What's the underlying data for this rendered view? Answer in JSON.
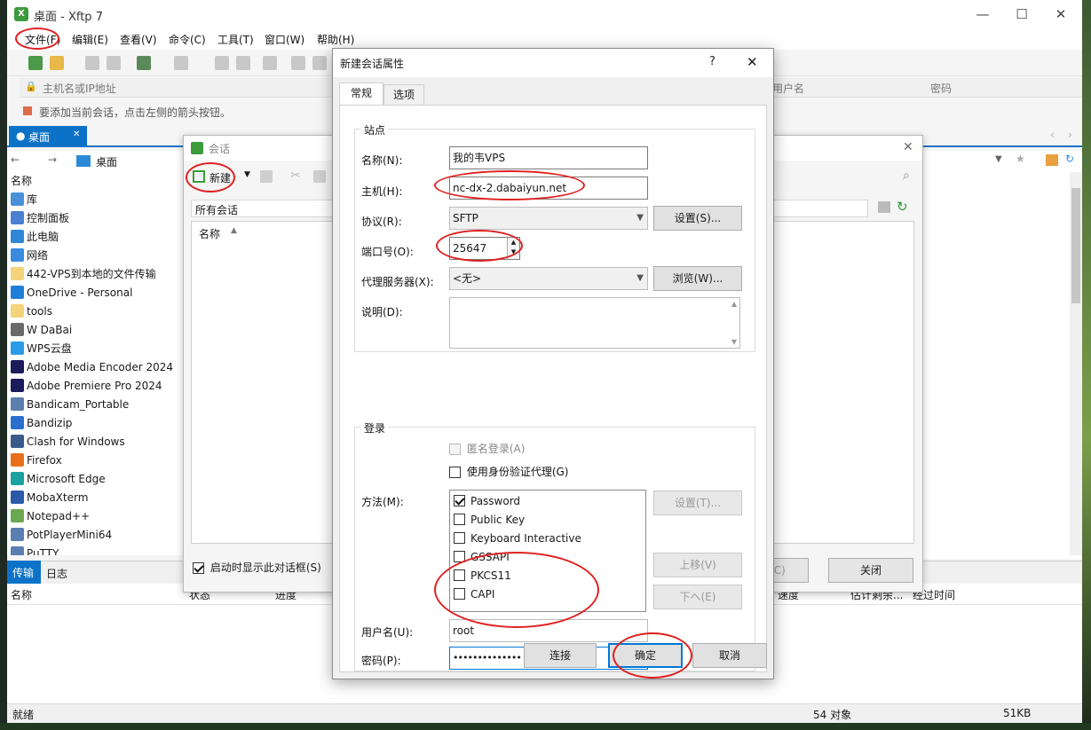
{
  "window": {
    "title": "桌面 - Xftp 7",
    "app_icon": "xftp-app-icon"
  },
  "menu": [
    "文件(F)",
    "编辑(E)",
    "查看(V)",
    "命令(C)",
    "工具(T)",
    "窗口(W)",
    "帮助(H)"
  ],
  "address": {
    "host_placeholder": "主机名或IP地址",
    "username_col": "用户名",
    "password_col": "密码"
  },
  "info_text": "要添加当前会话，点击左侧的箭头按钮。",
  "local_tab": {
    "label": "桌面"
  },
  "path": {
    "current": "桌面"
  },
  "file_list": {
    "header": "名称",
    "items": [
      {
        "label": "库",
        "icon": "library-icon",
        "color": "#4a90d9"
      },
      {
        "label": "控制面板",
        "icon": "control-panel-icon",
        "color": "#4a7fd1"
      },
      {
        "label": "此电脑",
        "icon": "computer-icon",
        "color": "#2f86d6"
      },
      {
        "label": "网络",
        "icon": "network-icon",
        "color": "#3a8be0"
      },
      {
        "label": "442-VPS到本地的文件传输",
        "icon": "folder-icon",
        "color": "#f4d37a"
      },
      {
        "label": "OneDrive - Personal",
        "icon": "onedrive-icon",
        "color": "#1f7fd8"
      },
      {
        "label": "tools",
        "icon": "folder-icon",
        "color": "#f4d37a"
      },
      {
        "label": "W DaBai",
        "icon": "user-icon",
        "color": "#6a6a6a"
      },
      {
        "label": "WPS云盘",
        "icon": "cloud-icon",
        "color": "#2a9be8"
      },
      {
        "label": "Adobe Media Encoder 2024",
        "icon": "media-encoder-icon",
        "color": "#1b1b5c"
      },
      {
        "label": "Adobe Premiere Pro 2024",
        "icon": "premiere-icon",
        "color": "#1b1b5c"
      },
      {
        "label": "Bandicam_Portable",
        "icon": "shortcut-icon",
        "color": "#5a7fb0"
      },
      {
        "label": "Bandizip",
        "icon": "bandizip-icon",
        "color": "#2a6fd0"
      },
      {
        "label": "Clash for Windows",
        "icon": "clash-icon",
        "color": "#3a5a8a"
      },
      {
        "label": "Firefox",
        "icon": "firefox-icon",
        "color": "#e8701a"
      },
      {
        "label": "Microsoft Edge",
        "icon": "edge-icon",
        "color": "#1aa2a0"
      },
      {
        "label": "MobaXterm",
        "icon": "mobaxterm-icon",
        "color": "#2a5aa8"
      },
      {
        "label": "Notepad++",
        "icon": "notepad-icon",
        "color": "#6aa84f"
      },
      {
        "label": "PotPlayerMini64",
        "icon": "potplayer-icon",
        "color": "#5a7fb0"
      },
      {
        "label": "PuTTY",
        "icon": "putty-icon",
        "color": "#5a7fb0"
      }
    ]
  },
  "bottom_tabs": {
    "transfer": "传输",
    "log": "日志"
  },
  "transfer_columns": [
    "名称",
    "状态",
    "进度",
    "速度",
    "估计剩余...",
    "经过时间"
  ],
  "status": {
    "left": "就绪",
    "objects": "54 对象",
    "size": "51KB"
  },
  "sessions_dialog": {
    "title": "会话",
    "new_button": "新建",
    "folder": "所有会话",
    "list_header": "名称",
    "show_on_start": "启动时显示此对话框(S)",
    "connect_button": "连接(C)",
    "close_button": "关闭"
  },
  "prop_dialog": {
    "title": "新建会话属性",
    "help": "?",
    "tabs": [
      "常规",
      "选项"
    ],
    "site_group": "站点",
    "name_label": "名称(N):",
    "name_value": "我的韦VPS",
    "host_label": "主机(H):",
    "host_value": "nc-dx-2.dabaiyun.net",
    "protocol_label": "协议(R):",
    "protocol_value": "SFTP",
    "settings_button": "设置(S)...",
    "port_label": "端口号(O):",
    "port_value": "25647",
    "proxy_label": "代理服务器(X):",
    "proxy_value": "<无>",
    "browse_button": "浏览(W)...",
    "desc_label": "说明(D):",
    "login_group": "登录",
    "anonymous": "匿名登录(A)",
    "use_agent": "使用身份验证代理(G)",
    "method_label": "方法(M):",
    "methods": [
      {
        "label": "Password",
        "checked": true
      },
      {
        "label": "Public Key",
        "checked": false
      },
      {
        "label": "Keyboard Interactive",
        "checked": false
      },
      {
        "label": "GSSAPI",
        "checked": false
      },
      {
        "label": "PKCS11",
        "checked": false
      },
      {
        "label": "CAPI",
        "checked": false
      }
    ],
    "method_settings": "设置(T)...",
    "move_up": "上移(V)",
    "move_down": "下へ(E)",
    "username_label": "用户名(U):",
    "username_value": "root",
    "password_label": "密码(P):",
    "password_value": "••••••••••••••",
    "connect_button": "连接",
    "ok_button": "确定",
    "cancel_button": "取消"
  },
  "colors": {
    "accent": "#0c72c8",
    "annotation": "#e02020",
    "xftp_green": "#3c9b3c"
  }
}
